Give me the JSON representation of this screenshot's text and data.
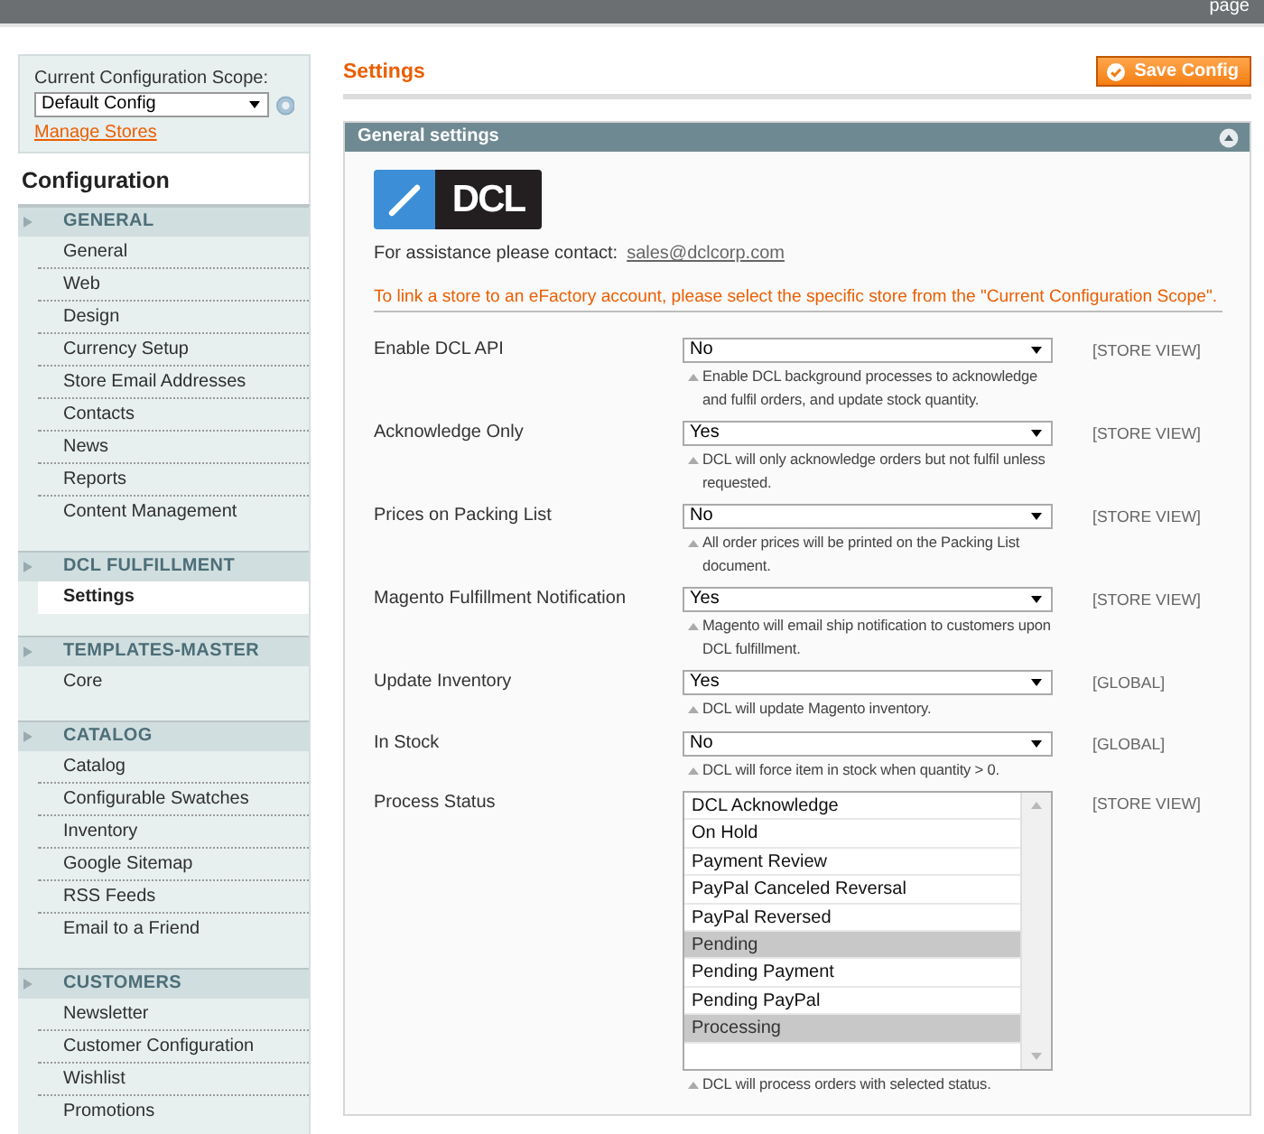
{
  "top_bar": {
    "text": "page"
  },
  "sidebar": {
    "scope": {
      "label": "Current Configuration Scope:",
      "value": "Default Config",
      "link": "Manage Stores"
    },
    "heading": "Configuration",
    "sections": [
      {
        "title": "GENERAL",
        "items": [
          {
            "label": "General",
            "selected": false
          },
          {
            "label": "Web",
            "selected": false
          },
          {
            "label": "Design",
            "selected": false
          },
          {
            "label": "Currency Setup",
            "selected": false
          },
          {
            "label": "Store Email Addresses",
            "selected": false
          },
          {
            "label": "Contacts",
            "selected": false
          },
          {
            "label": "News",
            "selected": false
          },
          {
            "label": "Reports",
            "selected": false
          },
          {
            "label": "Content Management",
            "selected": false
          }
        ]
      },
      {
        "title": "DCL FULFILLMENT",
        "items": [
          {
            "label": "Settings",
            "selected": true
          }
        ]
      },
      {
        "title": "TEMPLATES-MASTER",
        "items": [
          {
            "label": "Core",
            "selected": false
          }
        ]
      },
      {
        "title": "CATALOG",
        "items": [
          {
            "label": "Catalog",
            "selected": false
          },
          {
            "label": "Configurable Swatches",
            "selected": false
          },
          {
            "label": "Inventory",
            "selected": false
          },
          {
            "label": "Google Sitemap",
            "selected": false
          },
          {
            "label": "RSS Feeds",
            "selected": false
          },
          {
            "label": "Email to a Friend",
            "selected": false
          }
        ]
      },
      {
        "title": "CUSTOMERS",
        "items": [
          {
            "label": "Newsletter",
            "selected": false
          },
          {
            "label": "Customer Configuration",
            "selected": false
          },
          {
            "label": "Wishlist",
            "selected": false
          },
          {
            "label": "Promotions",
            "selected": false
          }
        ]
      }
    ]
  },
  "main": {
    "title": "Settings",
    "save_button": "Save Config",
    "panel": {
      "title": "General settings",
      "expanded": true,
      "logo_text": "DCL",
      "assistance": {
        "label": "For assistance please contact:",
        "email": "sales@dclcorp.com"
      },
      "notice": "To link a store to an eFactory account, please select the specific store from the \"Current Configuration Scope\".",
      "fields": [
        {
          "kind": "select",
          "label": "Enable DCL API",
          "value": "No",
          "note": "Enable DCL background processes to acknowledge and fulfil orders, and update stock quantity.",
          "scope": "[STORE VIEW]"
        },
        {
          "kind": "select",
          "label": "Acknowledge Only",
          "value": "Yes",
          "note": "DCL will only acknowledge orders but not fulfil unless requested.",
          "scope": "[STORE VIEW]"
        },
        {
          "kind": "select",
          "label": "Prices on Packing List",
          "value": "No",
          "note": "All order prices will be printed on the Packing List document.",
          "scope": "[STORE VIEW]"
        },
        {
          "kind": "select",
          "label": "Magento Fulfillment Notification",
          "value": "Yes",
          "note": "Magento will email ship notification to customers upon DCL fulfillment.",
          "scope": "[STORE VIEW]"
        },
        {
          "kind": "select",
          "label": "Update Inventory",
          "value": "Yes",
          "note": "DCL will update Magento inventory.",
          "scope": "[GLOBAL]"
        },
        {
          "kind": "select",
          "label": "In Stock",
          "value": "No",
          "note": "DCL will force item in stock when quantity > 0.",
          "scope": "[GLOBAL]"
        },
        {
          "kind": "multiselect",
          "label": "Process Status",
          "options": [
            {
              "label": "DCL Acknowledge",
              "selected": false
            },
            {
              "label": "On Hold",
              "selected": false
            },
            {
              "label": "Payment Review",
              "selected": false
            },
            {
              "label": "PayPal Canceled Reversal",
              "selected": false
            },
            {
              "label": "PayPal Reversed",
              "selected": false
            },
            {
              "label": "Pending",
              "selected": true
            },
            {
              "label": "Pending Payment",
              "selected": false
            },
            {
              "label": "Pending PayPal",
              "selected": false
            },
            {
              "label": "Processing",
              "selected": true
            }
          ],
          "note": "DCL will process orders with selected status.",
          "scope": "[STORE VIEW]"
        }
      ]
    }
  }
}
